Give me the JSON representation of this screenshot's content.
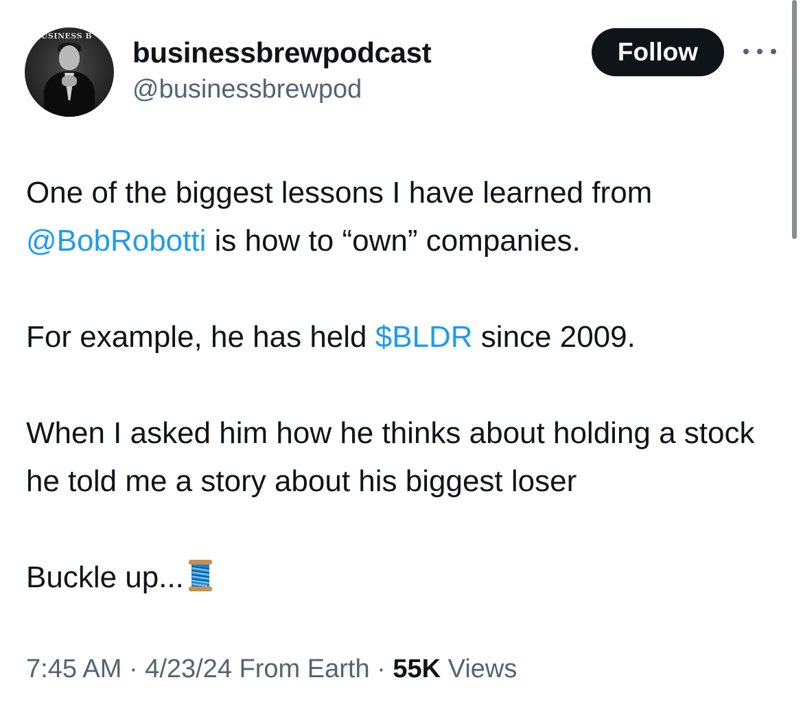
{
  "author": {
    "display_name": "businessbrewpodcast",
    "handle": "@businessbrewpod",
    "avatar_banner_text": "BUSINESS B"
  },
  "actions": {
    "follow_label": "Follow",
    "more_icon": "more-horizontal-icon"
  },
  "tweet": {
    "line1_a": "One of the biggest lessons I have learned from",
    "line1_mention": "@BobRobotti",
    "line1_b": " is how to “own” companies.",
    "line2_a": "For example, he has held ",
    "line2_cashtag": "$BLDR",
    "line2_b": " since 2009.",
    "line3": "When I asked him how he thinks about holding a stock he told me a story about his biggest loser",
    "line4": "Buckle up...",
    "emoji_icon": "thread-spool-icon"
  },
  "meta": {
    "time": "7:45 AM",
    "sep1": " · ",
    "date": "4/23/24",
    "source": " From Earth",
    "sep2": " · ",
    "views_count": "55K",
    "views_label": " Views"
  },
  "colors": {
    "link": "#1d9bf0",
    "text": "#0f1419",
    "secondary": "#536471",
    "follow_bg": "#0f1419"
  }
}
